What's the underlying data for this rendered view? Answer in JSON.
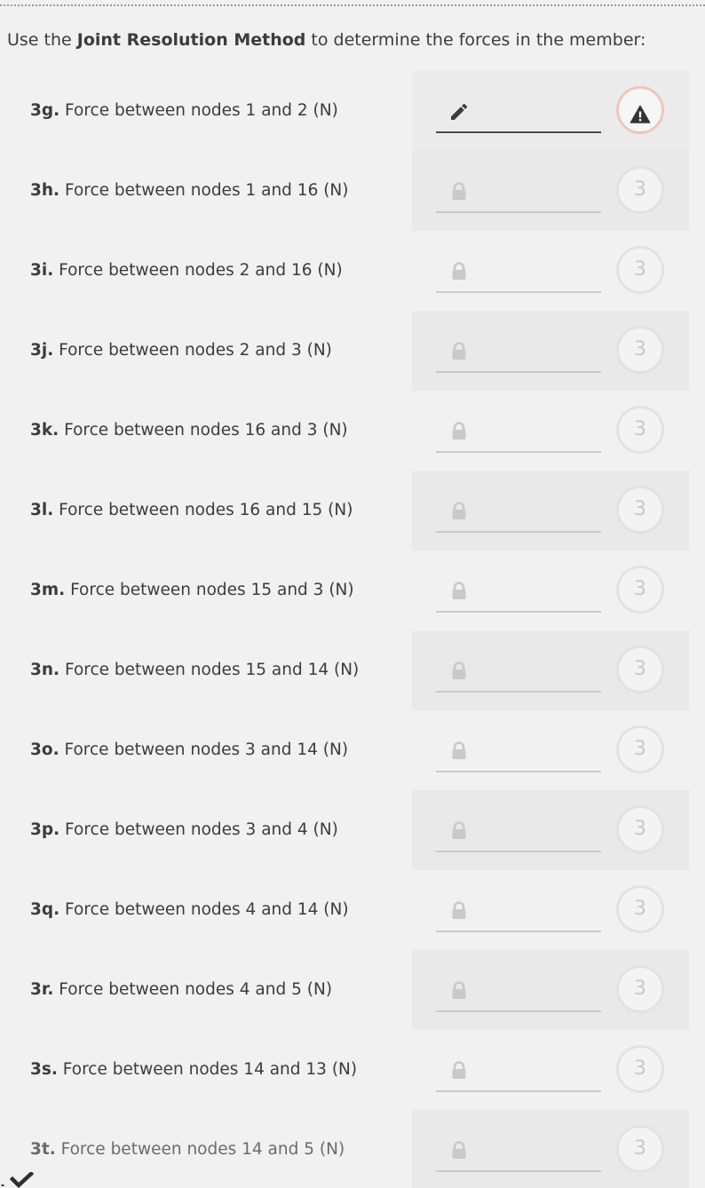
{
  "instructions": {
    "prefix": "Use the ",
    "method": "Joint Resolution Method",
    "suffix": " to determine the forces in the member:"
  },
  "questions": [
    {
      "code": "3g.",
      "text": " Force between nodes 1 and 2 (N)",
      "state": "active",
      "badge_icon": "warning-icon"
    },
    {
      "code": "3h.",
      "text": " Force between nodes 1 and 16 (N)",
      "state": "locked",
      "badge": "3"
    },
    {
      "code": "3i.",
      "text": " Force between nodes 2 and 16 (N)",
      "state": "locked",
      "badge": "3"
    },
    {
      "code": "3j.",
      "text": " Force between nodes 2 and 3 (N)",
      "state": "locked",
      "badge": "3"
    },
    {
      "code": "3k.",
      "text": " Force between nodes 16 and 3 (N)",
      "state": "locked",
      "badge": "3"
    },
    {
      "code": "3l.",
      "text": " Force between nodes 16 and 15 (N)",
      "state": "locked",
      "badge": "3"
    },
    {
      "code": "3m.",
      "text": " Force between nodes 15 and 3 (N)",
      "state": "locked",
      "badge": "3"
    },
    {
      "code": "3n.",
      "text": " Force between nodes 15 and 14 (N)",
      "state": "locked",
      "badge": "3"
    },
    {
      "code": "3o.",
      "text": " Force between nodes 3 and 14 (N)",
      "state": "locked",
      "badge": "3"
    },
    {
      "code": "3p.",
      "text": " Force between nodes 3 and 4 (N)",
      "state": "locked",
      "badge": "3"
    },
    {
      "code": "3q.",
      "text": " Force between nodes 4 and 14 (N)",
      "state": "locked",
      "badge": "3"
    },
    {
      "code": "3r.",
      "text": " Force between nodes 4 and 5 (N)",
      "state": "locked",
      "badge": "3"
    },
    {
      "code": "3s.",
      "text": " Force between nodes 14 and 13 (N)",
      "state": "locked",
      "badge": "3"
    },
    {
      "code": "3t.",
      "text": " Force between nodes 14 and 5 (N)",
      "state": "locked",
      "badge": "3"
    }
  ],
  "icons": {
    "edit": "pencil-icon",
    "locked": "lock-icon",
    "warning": "warning-icon",
    "footer": "checkmark-icon"
  },
  "colors": {
    "warning_ring": "#ecc7bd",
    "text": "#3c3c3c",
    "muted": "#c9c9c9"
  }
}
